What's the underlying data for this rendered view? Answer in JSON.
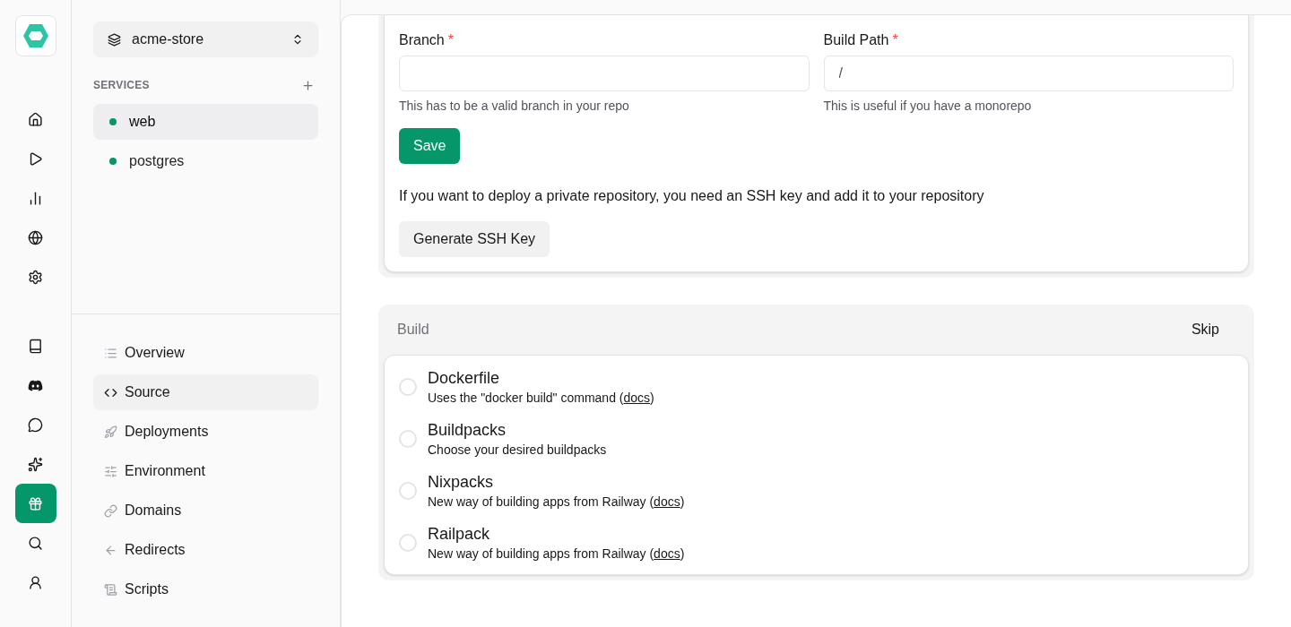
{
  "rail": {
    "items": [
      {
        "kind": "home",
        "selected": false
      },
      {
        "kind": "play",
        "selected": false
      },
      {
        "kind": "chart",
        "selected": false
      },
      {
        "kind": "globe",
        "selected": false
      },
      {
        "kind": "settings",
        "selected": false
      }
    ],
    "bottom_items": [
      {
        "kind": "book",
        "selected": false
      },
      {
        "kind": "discord",
        "selected": false
      },
      {
        "kind": "chat",
        "selected": false
      },
      {
        "kind": "sparkles",
        "selected": false
      },
      {
        "kind": "gift",
        "selected": true
      },
      {
        "kind": "search",
        "selected": false
      },
      {
        "kind": "user",
        "selected": false
      }
    ]
  },
  "sidebar": {
    "project": "acme-store",
    "services_heading": "SERVICES",
    "services": [
      {
        "name": "web",
        "selected": true,
        "color": "#059669"
      },
      {
        "name": "postgres",
        "selected": false,
        "color": "#059669"
      }
    ],
    "nav": [
      {
        "kind": "list",
        "label": "Overview",
        "selected": false
      },
      {
        "kind": "code",
        "label": "Source",
        "selected": true
      },
      {
        "kind": "rocket",
        "label": "Deployments",
        "selected": false
      },
      {
        "kind": "sliders",
        "label": "Environment",
        "selected": false
      },
      {
        "kind": "link",
        "label": "Domains",
        "selected": false
      },
      {
        "kind": "arrow",
        "label": "Redirects",
        "selected": false
      },
      {
        "kind": "scroll",
        "label": "Scripts",
        "selected": false
      }
    ]
  },
  "source": {
    "fields": [
      {
        "label": "Branch",
        "required_mark": "*",
        "hint": "This has to be a valid branch in your repo"
      },
      {
        "label": "Build Path",
        "required_mark": "*",
        "placeholder": "/",
        "hint": "This is useful if you have a monorepo"
      }
    ],
    "save_button": "Save",
    "ssh_note": "If you want to deploy a private repository, you need an SSH key and add it to your repository",
    "ssh_button": "Generate SSH Key"
  },
  "build": {
    "title": "Build",
    "skip_button": "Skip",
    "options": [
      {
        "name": "Dockerfile",
        "description": "Uses the \"docker build\" command (",
        "link": "docs",
        "after": ")",
        "selected": false
      },
      {
        "name": "Buildpacks",
        "description": "Choose your desired buildpacks",
        "selected": false
      },
      {
        "name": "Nixpacks",
        "description": "New way of building apps from Railway (",
        "link": "docs",
        "after": ")",
        "selected": false
      },
      {
        "name": "Railpack",
        "description": "New way of building apps from Railway (",
        "link": "docs",
        "after": ")",
        "selected": false
      }
    ]
  }
}
